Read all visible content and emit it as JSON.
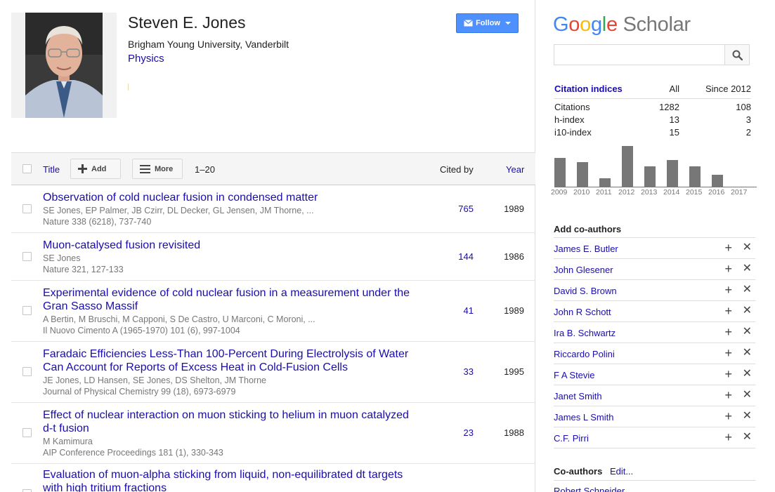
{
  "profile": {
    "name": "Steven E. Jones",
    "affiliation": "Brigham Young University, Vanderbilt",
    "interest": "Physics",
    "follow_label": "Follow"
  },
  "table_header": {
    "title": "Title",
    "add": "Add",
    "more": "More",
    "range": "1–20",
    "cited_by": "Cited by",
    "year": "Year"
  },
  "articles": [
    {
      "title": "Observation of cold nuclear fusion in condensed matter",
      "authors": "SE Jones, EP Palmer, JB Czirr, DL Decker, GL Jensen, JM Thorne, ...",
      "venue": "Nature 338 (6218), 737-740",
      "cites": "765",
      "year": "1989"
    },
    {
      "title": "Muon-catalysed fusion revisited",
      "authors": "SE Jones",
      "venue": "Nature 321, 127-133",
      "cites": "144",
      "year": "1986"
    },
    {
      "title": "Experimental evidence of cold nuclear fusion in a measurement under the Gran Sasso Massif",
      "authors": "A Bertin, M Bruschi, M Capponi, S De Castro, U Marconi, C Moroni, ...",
      "venue": "Il Nuovo Cimento A (1965-1970) 101 (6), 997-1004",
      "cites": "41",
      "year": "1989"
    },
    {
      "title": "Faradaic Efficiencies Less-Than 100-Percent During Electrolysis of Water Can Account for Reports of Excess Heat in Cold-Fusion Cells",
      "authors": "JE Jones, LD Hansen, SE Jones, DS Shelton, JM Thorne",
      "venue": "Journal of Physical Chemistry 99 (18), 6973-6979",
      "cites": "33",
      "year": "1995"
    },
    {
      "title": "Effect of nuclear interaction on muon sticking to helium in muon catalyzed d-t fusion",
      "authors": "M Kamimura",
      "venue": "AIP Conference Proceedings 181 (1), 330-343",
      "cites": "23",
      "year": "1988"
    },
    {
      "title": "Evaluation of muon-alpha sticking from liquid, non-equilibrated dt targets with high tritium fractions",
      "authors": "",
      "venue": "",
      "cites": "",
      "year": ""
    }
  ],
  "sidebar": {
    "logo_google": "Google",
    "logo_scholar": "Scholar",
    "citation_indices": {
      "heading": "Citation indices",
      "col_all": "All",
      "col_since": "Since 2012",
      "rows": [
        {
          "label": "Citations",
          "all": "1282",
          "since": "108"
        },
        {
          "label": "h-index",
          "all": "13",
          "since": "3"
        },
        {
          "label": "i10-index",
          "all": "15",
          "since": "2"
        }
      ]
    },
    "add_coauthors_title": "Add co-authors",
    "suggested_coauthors": [
      "James E. Butler",
      "John Glesener",
      "David S. Brown",
      "John R Schott",
      "Ira B. Schwartz",
      "Riccardo Polini",
      "F A Stevie",
      "Janet Smith",
      "James L Smith",
      "C.F. Pirri"
    ],
    "coauthors_title": "Co-authors",
    "coauthors_edit": "Edit...",
    "coauthors": [
      "Robert Schneider"
    ]
  },
  "chart_data": {
    "type": "bar",
    "title": "",
    "categories": [
      "2009",
      "2010",
      "2011",
      "2012",
      "2013",
      "2014",
      "2015",
      "2016",
      "2017"
    ],
    "values": [
      14,
      12,
      4,
      20,
      10,
      13,
      10,
      6,
      0
    ],
    "color": "#777777"
  },
  "colors": {
    "link": "#1a0dab",
    "follow_button": "#4d90fe",
    "google_blue": "#4285f4",
    "google_red": "#ea4335",
    "google_yellow": "#fbbc05",
    "google_green": "#34a853",
    "scholar_gray": "#777777"
  },
  "icons": {
    "search": "search-icon",
    "mail": "mail-icon",
    "add": "plus-icon",
    "more": "menu-icon",
    "dismiss": "close-icon"
  }
}
